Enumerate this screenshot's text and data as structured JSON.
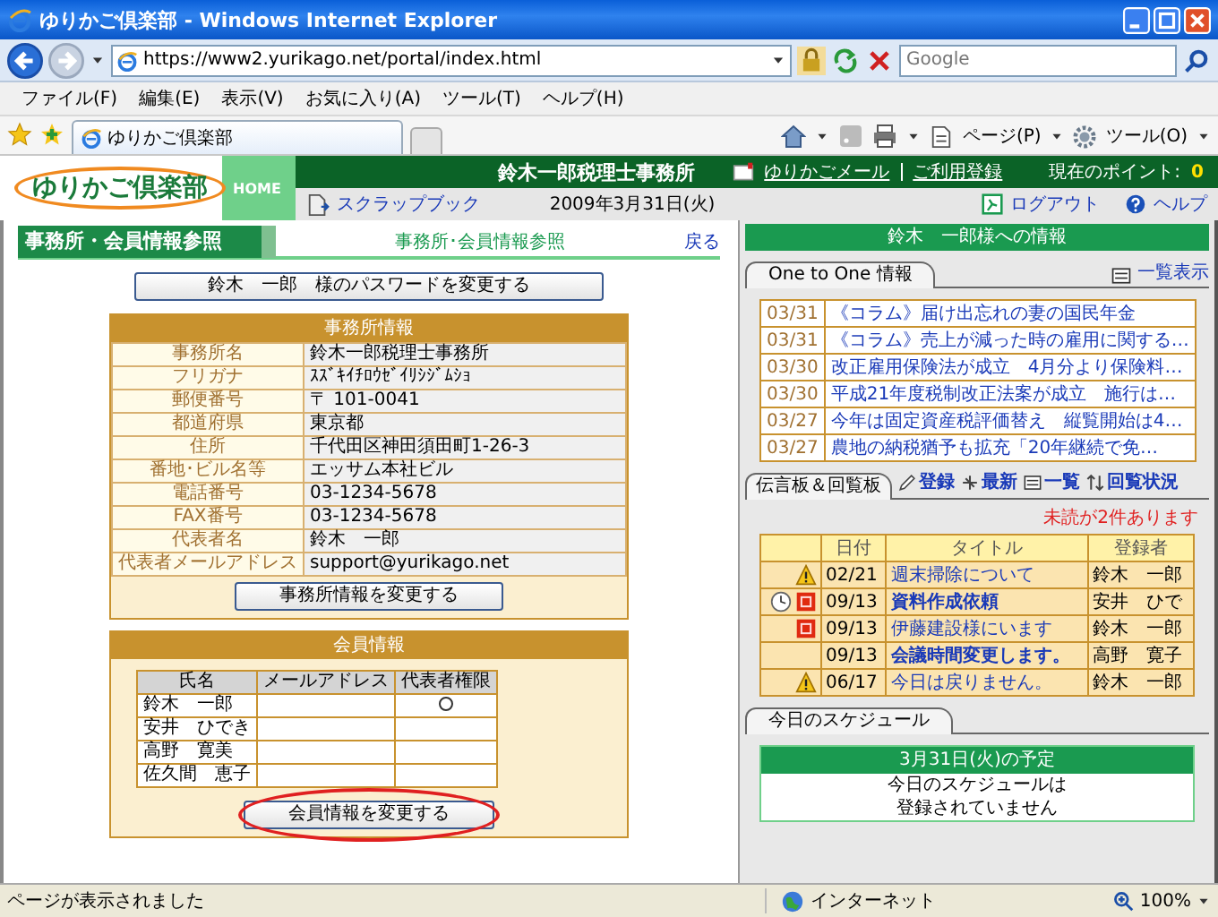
{
  "browser": {
    "title": "ゆりかご倶楽部 - Windows Internet Explorer",
    "address": "https://www2.yurikago.net/portal/index.html",
    "search_placeholder": "Google",
    "menu": [
      "ファイル(F)",
      "編集(E)",
      "表示(V)",
      "お気に入り(A)",
      "ツール(T)",
      "ヘルプ(H)"
    ],
    "tab": "ゆりかご倶楽部",
    "tools": [
      "ページ(P)",
      "ツール(O)"
    ]
  },
  "header": {
    "logo": "ゆりかご倶楽部",
    "home": "HOME",
    "office_name": "鈴木一郎税理士事務所",
    "scrapbook": "スクラップブック",
    "date": "2009年3月31日(火)",
    "links": [
      "ゆりかごメール",
      "ご利用登録"
    ],
    "points_label": "現在のポイント:",
    "points": "0",
    "logout": "ログアウト",
    "help": "ヘルプ"
  },
  "page": {
    "title": "事務所・会員情報参照",
    "breadcrumb": "事務所･会員情報参照",
    "back": "戻る",
    "password_button": "鈴木　一郎　様のパスワードを変更する"
  },
  "office": {
    "title": "事務所情報",
    "rows": [
      {
        "label": "事務所名",
        "value": "鈴木一郎税理士事務所"
      },
      {
        "label": "フリガナ",
        "value": "ｽｽﾞｷｲﾁﾛｳｾﾞｲﾘｼｼﾞﾑｼｮ"
      },
      {
        "label": "郵便番号",
        "value": "〒 101-0041"
      },
      {
        "label": "都道府県",
        "value": "東京都"
      },
      {
        "label": "住所",
        "value": "千代田区神田須田町1-26-3"
      },
      {
        "label": "番地･ビル名等",
        "value": "エッサム本社ビル"
      },
      {
        "label": "電話番号",
        "value": "03-1234-5678"
      },
      {
        "label": "FAX番号",
        "value": "03-1234-5678"
      },
      {
        "label": "代表者名",
        "value": "鈴木　一郎"
      },
      {
        "label": "代表者メールアドレス",
        "value": "support@yurikago.net"
      }
    ],
    "button": "事務所情報を変更する"
  },
  "members": {
    "title": "会員情報",
    "columns": [
      "氏名",
      "メールアドレス",
      "代表者権限"
    ],
    "rows": [
      {
        "name": "鈴木　一郎",
        "representative": true
      },
      {
        "name": "安井　ひでき",
        "representative": false
      },
      {
        "name": "高野　寛美",
        "representative": false
      },
      {
        "name": "佐久間　恵子",
        "representative": false
      }
    ],
    "button": "会員情報を変更する",
    "circled": true
  },
  "sidebar": {
    "greeting": "鈴木　一郎様への情報",
    "news_tab": "One to One 情報",
    "news_list_link": "一覧表示",
    "news": [
      {
        "date": "03/31",
        "title": "《コラム》届け出忘れの妻の国民年金"
      },
      {
        "date": "03/31",
        "title": "《コラム》売上が減った時の雇用に関する…"
      },
      {
        "date": "03/30",
        "title": "改正雇用保険法が成立　4月分より保険料…"
      },
      {
        "date": "03/30",
        "title": "平成21年度税制改正法案が成立　施行は…"
      },
      {
        "date": "03/27",
        "title": "今年は固定資産税評価替え　縦覧開始は4…"
      },
      {
        "date": "03/27",
        "title": "農地の納税猶予も拡充「20年継続で免…"
      }
    ],
    "board_tab": "伝言板＆回覧板",
    "board_actions": [
      {
        "kind": "register",
        "label": "登録"
      },
      {
        "kind": "latest",
        "label": "最新"
      },
      {
        "kind": "list",
        "label": "一覧"
      },
      {
        "kind": "status",
        "label": "回覧状況"
      }
    ],
    "unread": "未読が2件あります",
    "board_columns": [
      "日付",
      "タイトル",
      "登録者"
    ],
    "board": [
      {
        "warning": true,
        "reminder": false,
        "urgent": false,
        "date": "02/21",
        "title": "週末掃除について",
        "author": "鈴木　一郎",
        "unread": false
      },
      {
        "warning": false,
        "reminder": true,
        "urgent": true,
        "date": "09/13",
        "title": "資料作成依頼",
        "author": "安井　ひで",
        "unread": true
      },
      {
        "warning": false,
        "reminder": false,
        "urgent": true,
        "date": "09/13",
        "title": "伊藤建設様にいます",
        "author": "鈴木　一郎",
        "unread": false
      },
      {
        "warning": false,
        "reminder": false,
        "urgent": false,
        "date": "09/13",
        "title": "会議時間変更します。",
        "author": "高野　寛子",
        "unread": true
      },
      {
        "warning": true,
        "reminder": false,
        "urgent": false,
        "date": "06/17",
        "title": "今日は戻りません。",
        "author": "鈴木　一郎",
        "unread": false
      }
    ],
    "schedule_tab": "今日のスケジュール",
    "schedule_title": "3月31日(火)の予定",
    "schedule_lines": [
      "今日のスケジュールは",
      "登録されていません"
    ]
  },
  "status": {
    "text": "ページが表示されました",
    "zone": "インターネット",
    "zoom": "100%"
  }
}
